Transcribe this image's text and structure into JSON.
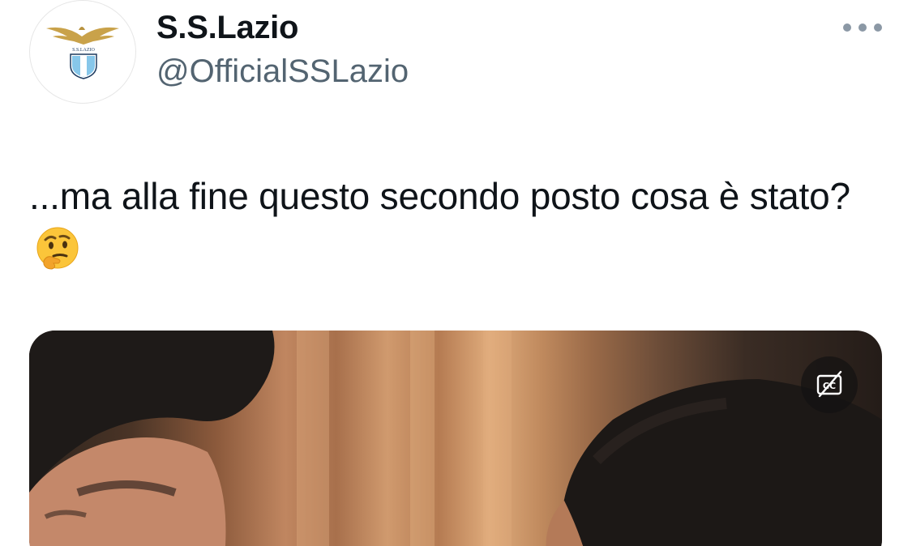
{
  "author": {
    "display_name": "S.S.Lazio",
    "handle": "@OfficialSSLazio",
    "avatar_logo_text": "S.S.LAZIO",
    "avatar_icon": "eagle-crest-icon"
  },
  "tweet": {
    "text": "...ma alla fine questo secondo posto cosa è stato?",
    "emoji_icon": "thinking-face-icon"
  },
  "media": {
    "type": "video-thumbnail",
    "captions_icon": "captions-off-icon"
  },
  "more_menu": {
    "icon": "more-horizontal-icon"
  },
  "colors": {
    "text_primary": "#0f1419",
    "text_secondary": "#536471",
    "icon_gray": "#8b98a5",
    "lazio_blue": "#87c7ea",
    "gold": "#c9a24a"
  }
}
